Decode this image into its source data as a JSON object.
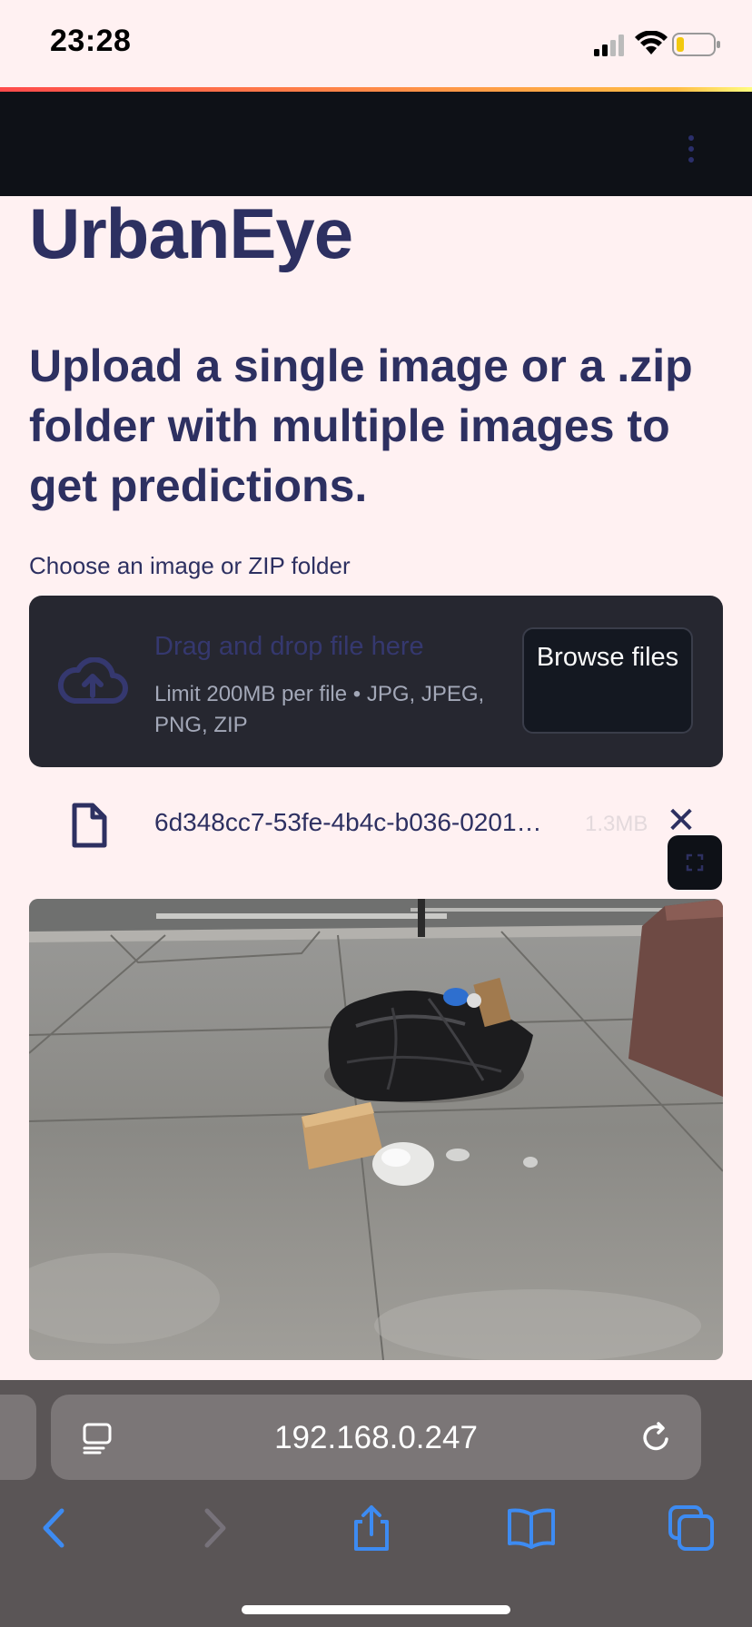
{
  "status_bar": {
    "time": "23:28"
  },
  "app": {
    "title": "UrbanEye",
    "subtitle": "Upload a single image or a .zip folder with multiple images to get predictions."
  },
  "uploader": {
    "label": "Choose an image or ZIP folder",
    "drop_text": "Drag and drop file here",
    "limit_text": "Limit 200MB per file • JPG, JPEG, PNG, ZIP",
    "browse_label": "Browse files"
  },
  "uploaded_file": {
    "name": "6d348cc7-53fe-4b4c-b036-0201…",
    "size": "1.3MB"
  },
  "image": {
    "subject": "trash bag and cardboard on sidewalk"
  },
  "browser": {
    "url": "192.168.0.247",
    "icons": [
      "reader-icon",
      "reload-icon",
      "back-icon",
      "forward-icon",
      "share-icon",
      "bookmarks-icon",
      "tabs-icon"
    ]
  },
  "colors": {
    "background": "#fff1f2",
    "header": "#0e1117",
    "text": "#2d3061",
    "dropzone": "#262730",
    "safari_accent": "#3d8bf2"
  }
}
